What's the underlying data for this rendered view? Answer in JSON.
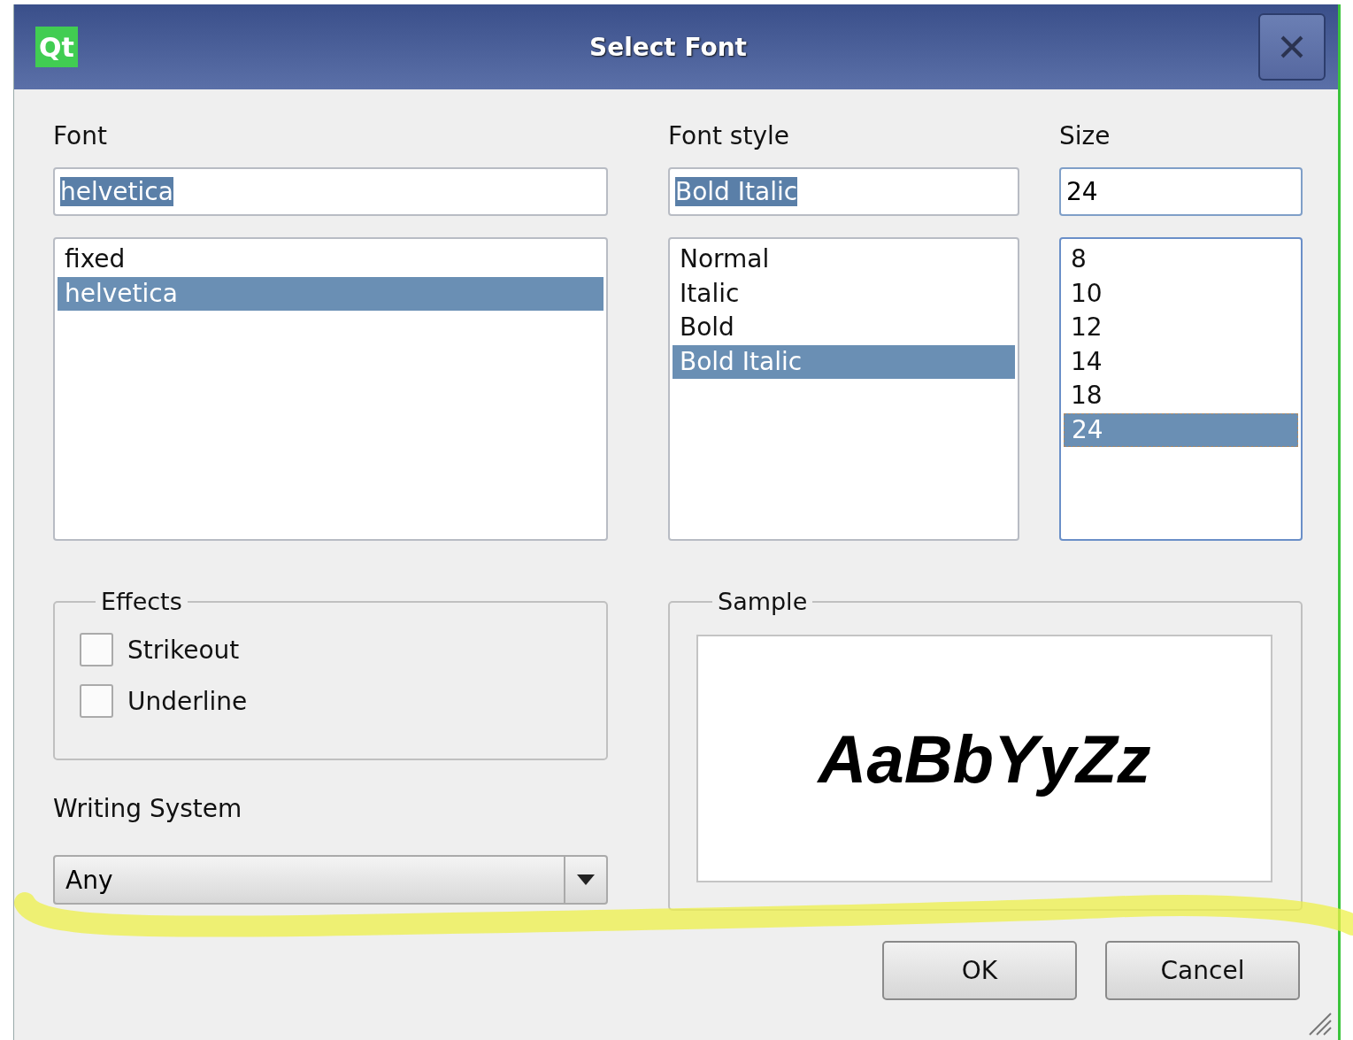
{
  "window": {
    "logo": "Qt",
    "title": "Select Font"
  },
  "font": {
    "label": "Font",
    "value": "helvetica",
    "text_selected": true,
    "focused": false,
    "items": [
      {
        "label": "fixed",
        "selected": false
      },
      {
        "label": "helvetica",
        "selected": true
      }
    ]
  },
  "font_style": {
    "label": "Font style",
    "value": "Bold Italic",
    "text_selected": true,
    "focused": false,
    "items": [
      {
        "label": "Normal",
        "selected": false
      },
      {
        "label": "Italic",
        "selected": false
      },
      {
        "label": "Bold",
        "selected": false
      },
      {
        "label": "Bold Italic",
        "selected": true
      }
    ]
  },
  "size": {
    "label": "Size",
    "value": "24",
    "text_selected": false,
    "focused": true,
    "items": [
      {
        "label": "8",
        "selected": false
      },
      {
        "label": "10",
        "selected": false
      },
      {
        "label": "12",
        "selected": false
      },
      {
        "label": "14",
        "selected": false
      },
      {
        "label": "18",
        "selected": false
      },
      {
        "label": "24",
        "selected": true
      }
    ]
  },
  "effects": {
    "title": "Effects",
    "options": [
      {
        "label": "Strikeout",
        "checked": false
      },
      {
        "label": "Underline",
        "checked": false
      }
    ]
  },
  "writing_system": {
    "label": "Writing System",
    "value": "Any"
  },
  "sample": {
    "title": "Sample",
    "text": "AaBbYyZz"
  },
  "buttons": [
    {
      "label": "OK"
    },
    {
      "label": "Cancel"
    }
  ]
}
